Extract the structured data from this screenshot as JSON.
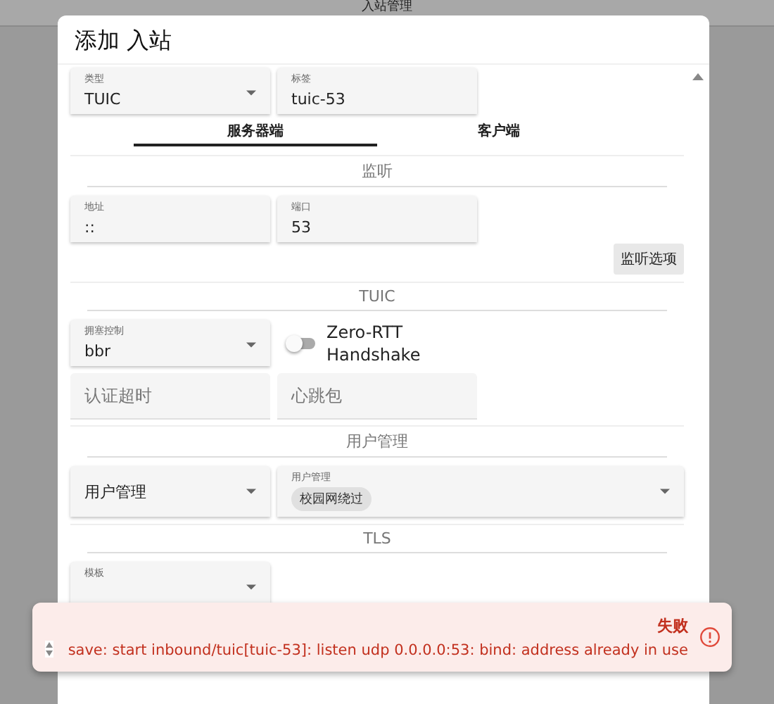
{
  "page": {
    "title": "入站管理"
  },
  "dialog": {
    "title": "添加 入站",
    "top_fields": [
      {
        "kind": "select",
        "label": "类型",
        "value": "TUIC"
      },
      {
        "kind": "text",
        "label": "标签",
        "value": "tuic-53"
      }
    ],
    "tabs": [
      {
        "label": "服务器端",
        "selected": true
      },
      {
        "label": "客户端",
        "selected": false
      }
    ],
    "sections": [
      {
        "heading": "监听",
        "rows": [
          {
            "items": [
              {
                "kind": "text",
                "label": "地址",
                "value": "::"
              },
              {
                "kind": "text",
                "label": "端口",
                "value": "53"
              }
            ]
          }
        ],
        "button": "监听选项"
      },
      {
        "heading": "TUIC",
        "rows": [
          {
            "items": [
              {
                "kind": "select",
                "label": "拥塞控制",
                "value": "bbr"
              },
              {
                "kind": "switch",
                "label": "Zero-RTT Handshake",
                "on": false
              }
            ]
          },
          {
            "items": [
              {
                "kind": "empty",
                "placeholder": "认证超时"
              },
              {
                "kind": "empty",
                "placeholder": "心跳包"
              }
            ]
          }
        ]
      },
      {
        "heading": "用户管理",
        "rows": [
          {
            "items": [
              {
                "kind": "select-empty",
                "placeholder": "用户管理"
              },
              {
                "kind": "chips",
                "label": "用户管理",
                "chips": [
                  "校园网绕过"
                ]
              }
            ]
          }
        ]
      },
      {
        "heading": "TLS",
        "rows": [
          {
            "items": [
              {
                "kind": "select",
                "label": "模板"
              }
            ]
          }
        ]
      }
    ]
  },
  "toast": {
    "title": "失败",
    "message": "save: start inbound/tuic[tuic-53]: listen udp 0.0.0.0:53: bind: address already in use"
  }
}
